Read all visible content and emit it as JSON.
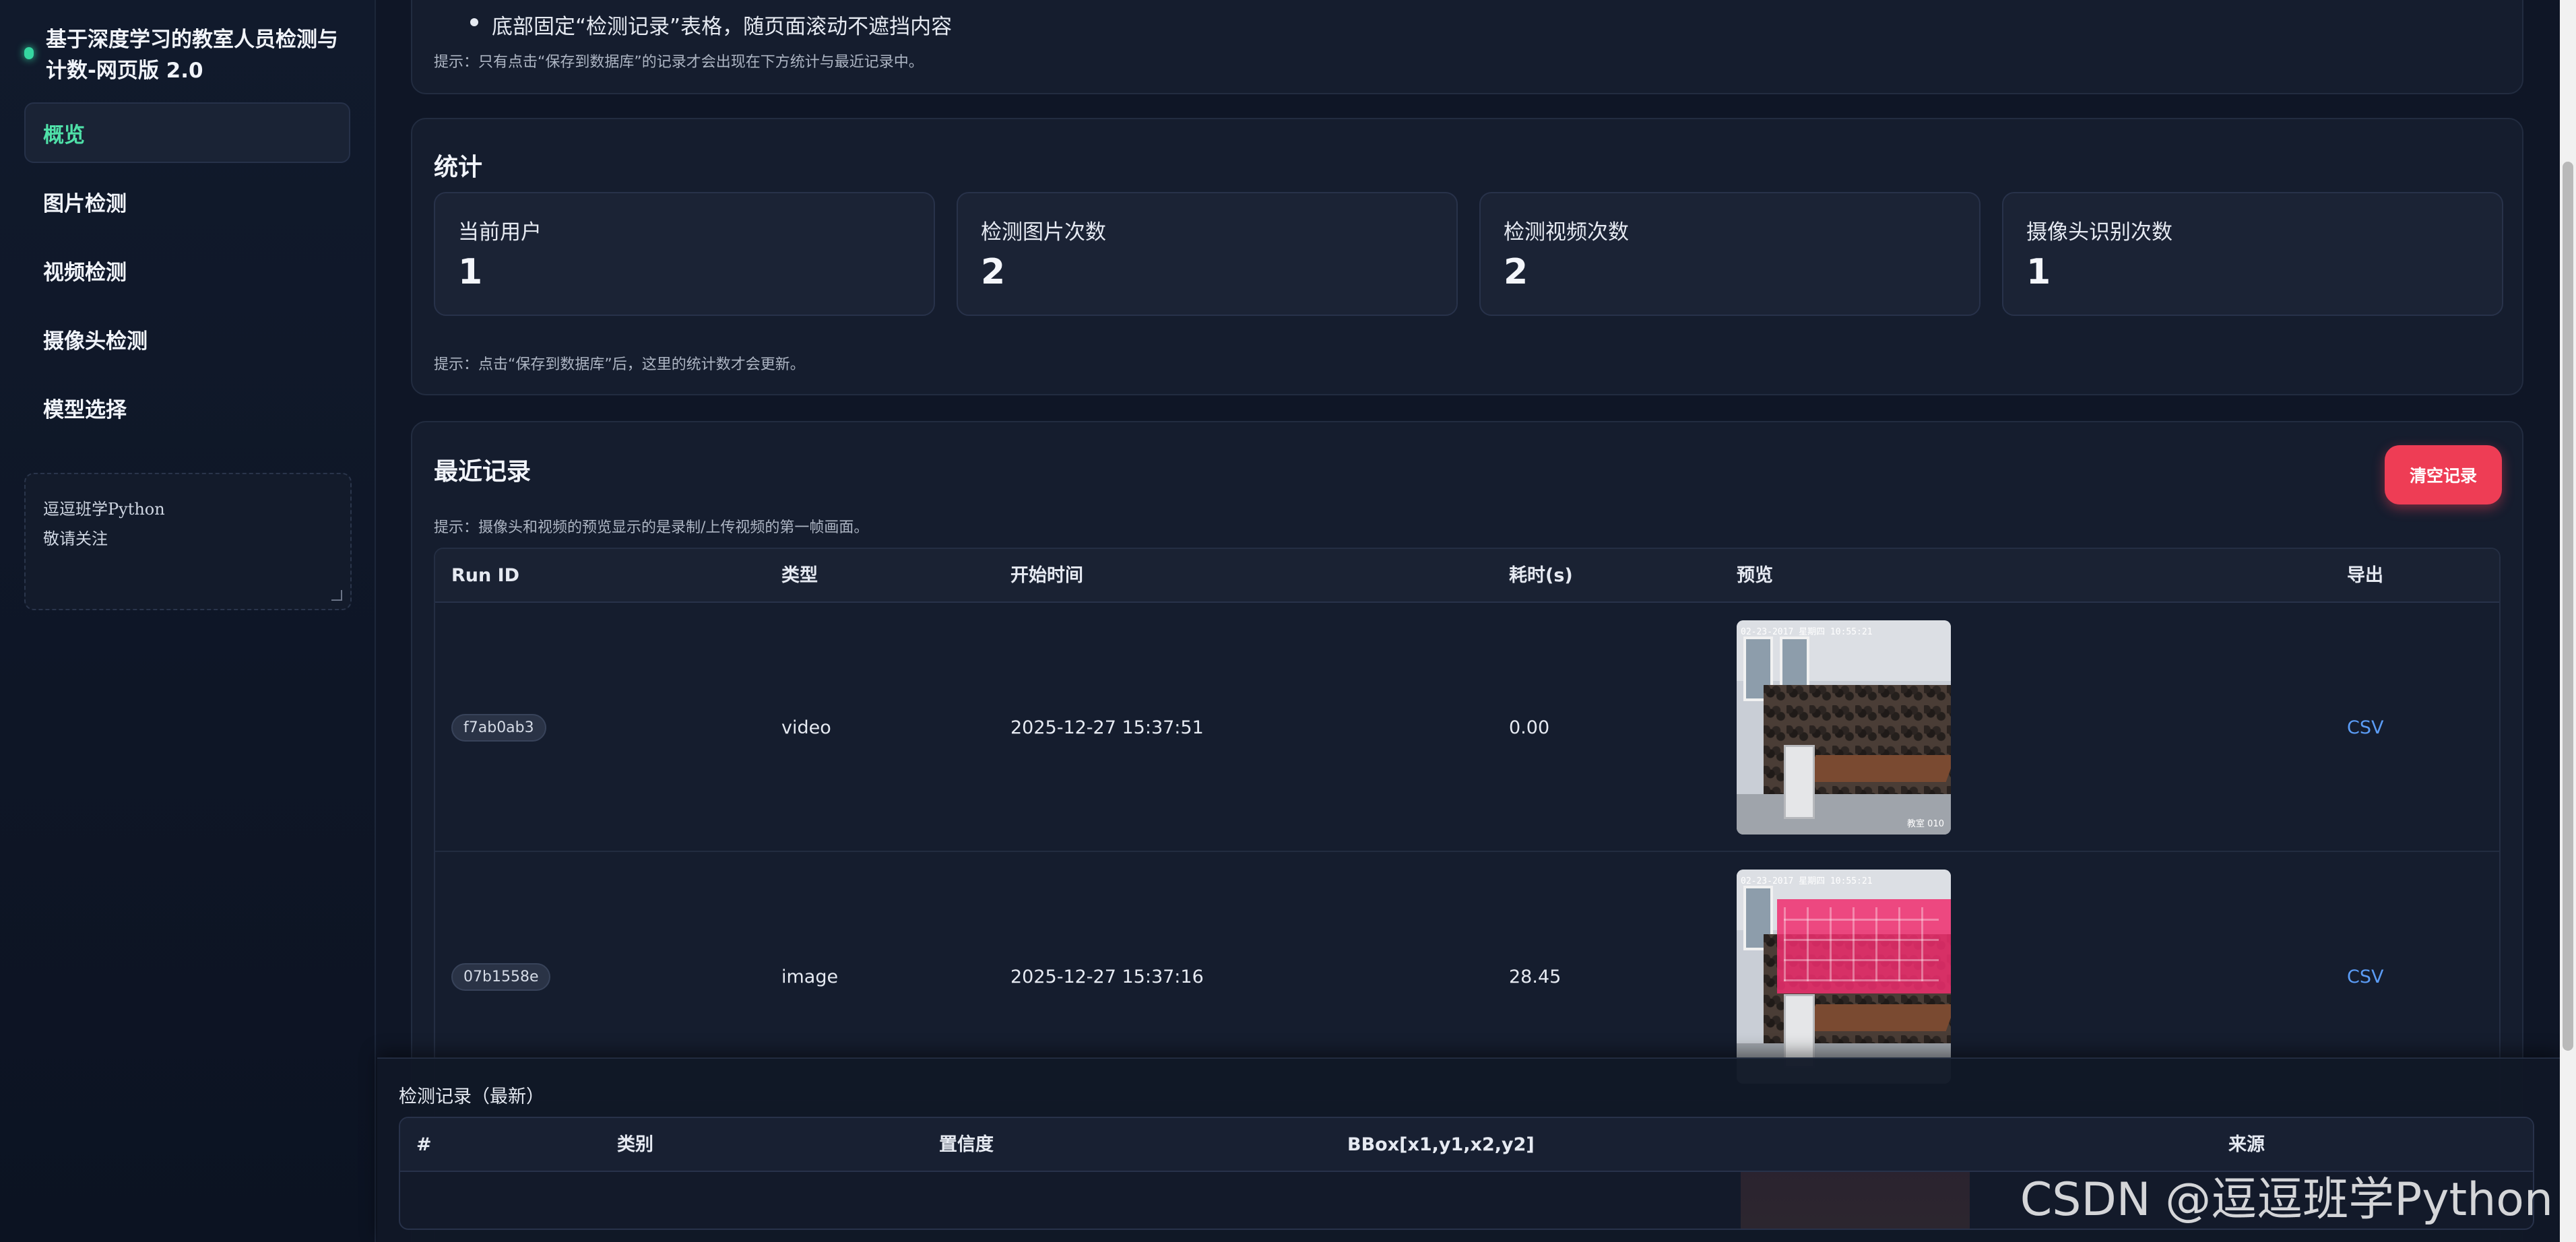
{
  "app": {
    "title": "基于深度学习的教室人员检测与计数-网页版 2.0"
  },
  "sidebar": {
    "items": [
      {
        "label": "概览",
        "active": true
      },
      {
        "label": "图片检测",
        "active": false
      },
      {
        "label": "视频检测",
        "active": false
      },
      {
        "label": "摄像头检测",
        "active": false
      },
      {
        "label": "模型选择",
        "active": false
      }
    ],
    "note_text": "逗逗班学Python\n敬请关注"
  },
  "intro": {
    "bullet": "底部固定“检测记录”表格，随页面滚动不遮挡内容",
    "hint": "提示：只有点击“保存到数据库”的记录才会出现在下方统计与最近记录中。"
  },
  "stats": {
    "title": "统计",
    "cards": [
      {
        "label": "当前用户",
        "value": "1"
      },
      {
        "label": "检测图片次数",
        "value": "2"
      },
      {
        "label": "检测视频次数",
        "value": "2"
      },
      {
        "label": "摄像头识别次数",
        "value": "1"
      }
    ],
    "hint": "提示：点击“保存到数据库”后，这里的统计数才会更新。"
  },
  "recent": {
    "title": "最近记录",
    "clear_label": "清空记录",
    "hint": "提示：摄像头和视频的预览显示的是录制/上传视频的第一帧画面。",
    "columns": [
      "Run ID",
      "类型",
      "开始时间",
      "耗时(s)",
      "预览",
      "导出"
    ],
    "rows": [
      {
        "run_id": "f7ab0ab3",
        "type": "video",
        "start": "2025-12-27 15:37:51",
        "duration": "0.00",
        "preview_stamp": "02-23-2017 星期四 10:55:21",
        "preview_mark": "教室 010",
        "export": "CSV"
      },
      {
        "run_id": "07b1558e",
        "type": "image",
        "start": "2025-12-27 15:37:16",
        "duration": "28.45",
        "preview_stamp": "02-23-2017 星期四 10:55:21",
        "preview_mark": "",
        "export": "CSV"
      }
    ]
  },
  "bottom_panel": {
    "title": "检测记录（最新）",
    "columns": [
      "#",
      "类别",
      "置信度",
      "BBox[x1,y1,x2,y2]",
      "来源"
    ]
  },
  "watermark": "CSDN @逗逗班学Python",
  "colors": {
    "background": "#0f1626",
    "card": "#151d2e",
    "accent_green": "#4fe0a8",
    "danger": "#ee3d55",
    "link": "#5b9cf5"
  }
}
